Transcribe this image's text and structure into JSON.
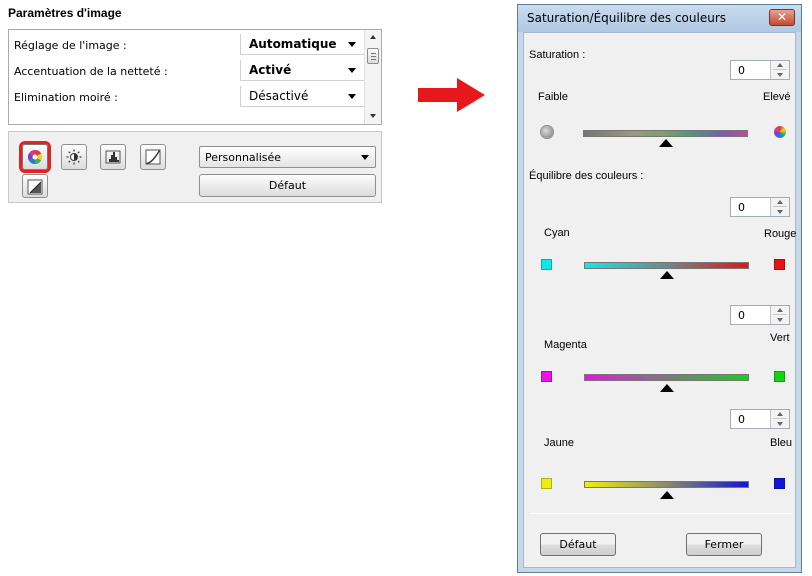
{
  "left_panel": {
    "title": "Paramètres d'image",
    "settings": [
      {
        "label": "Réglage de l'image :",
        "value": "Automatique"
      },
      {
        "label": "Accentuation de la netteté :",
        "value": "Activé"
      },
      {
        "label": "Elimination moiré :",
        "value": "Désactivé"
      }
    ],
    "tools": {
      "saturation_icon": "color-wheel-icon",
      "brightness_icon": "brightness-contrast-icon",
      "histogram_icon": "histogram-icon",
      "tone_curve_icon": "tone-curve-icon",
      "threshold_icon": "threshold-icon",
      "preset_value": "Personnalisée",
      "defaut_label": "Défaut",
      "highlight_color": "#e32222"
    }
  },
  "arrow": {
    "color": "#e8171c",
    "icon": "right-arrow-icon"
  },
  "dialog": {
    "title": "Saturation/Équilibre des couleurs",
    "close_label": "✕",
    "saturation": {
      "label": "Saturation :",
      "value": "0",
      "low_label": "Faible",
      "high_label": "Elevé",
      "level": 0.5
    },
    "balance_label": "Équilibre des couleurs :",
    "balances": [
      {
        "value": "0",
        "left_label": "Cyan",
        "right_label": "Rouge",
        "left_color": "#13e5e8",
        "right_color": "#e81313",
        "level": 0.5
      },
      {
        "value": "0",
        "left_label": "Magenta",
        "right_label": "Vert",
        "left_color": "#ea13e6",
        "right_color": "#13d316",
        "level": 0.5
      },
      {
        "value": "0",
        "left_label": "Jaune",
        "right_label": "Bleu",
        "left_color": "#eeee15",
        "right_color": "#1414d9",
        "level": 0.5
      }
    ],
    "default_button": "Défaut",
    "close_button": "Fermer"
  }
}
